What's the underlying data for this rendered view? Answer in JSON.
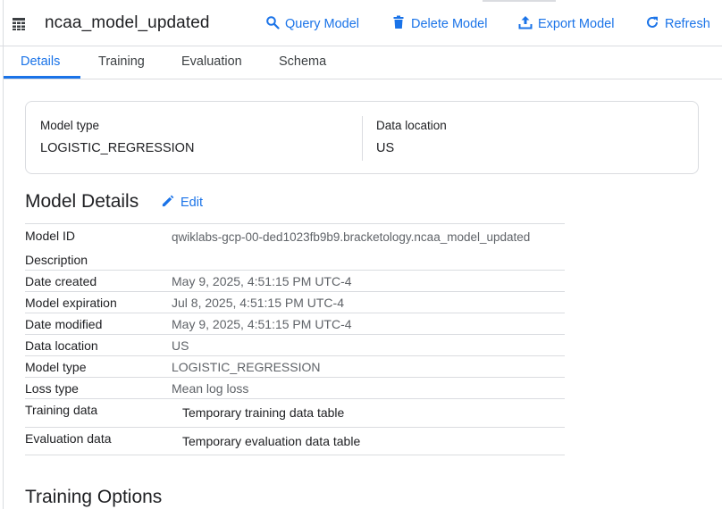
{
  "header": {
    "title": "ncaa_model_updated",
    "actions": {
      "query": "Query Model",
      "delete": "Delete Model",
      "export": "Export Model",
      "refresh": "Refresh"
    }
  },
  "tabs": [
    "Details",
    "Training",
    "Evaluation",
    "Schema"
  ],
  "active_tab": "Details",
  "summary": {
    "model_type_label": "Model type",
    "model_type_value": "LOGISTIC_REGRESSION",
    "data_location_label": "Data location",
    "data_location_value": "US"
  },
  "model_details": {
    "title": "Model Details",
    "edit_label": "Edit",
    "rows": [
      {
        "label": "Model ID",
        "value": "qwiklabs-gcp-00-ded1023fb9b9.bracketology.ncaa_model_updated"
      },
      {
        "label": "Description",
        "value": ""
      },
      {
        "label": "Date created",
        "value": "May 9, 2025, 4:51:15 PM UTC-4"
      },
      {
        "label": "Model expiration",
        "value": "Jul 8, 2025, 4:51:15 PM UTC-4"
      },
      {
        "label": "Date modified",
        "value": "May 9, 2025, 4:51:15 PM UTC-4"
      },
      {
        "label": "Data location",
        "value": "US"
      },
      {
        "label": "Model type",
        "value": "LOGISTIC_REGRESSION"
      },
      {
        "label": "Loss type",
        "value": "Mean log loss"
      },
      {
        "label": "Training data",
        "value": "Temporary training data table"
      },
      {
        "label": "Evaluation data",
        "value": "Temporary evaluation data table"
      }
    ]
  },
  "training_options": {
    "title": "Training Options"
  },
  "colors": {
    "accent": "#1a73e8",
    "text": "#202124",
    "muted": "#5f6368",
    "divider": "#dadce0"
  }
}
